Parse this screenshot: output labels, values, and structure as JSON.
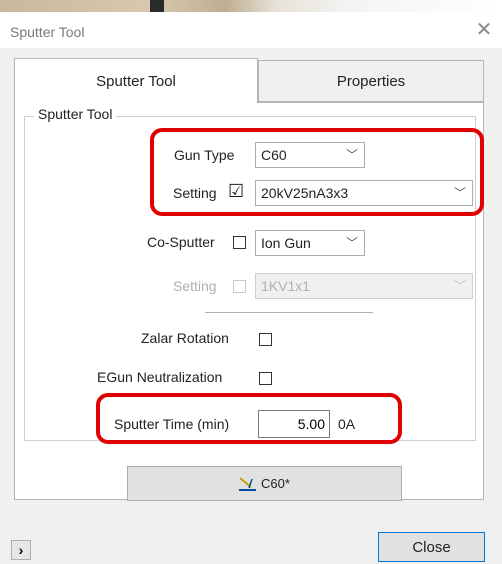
{
  "window": {
    "title": "Sputter Tool"
  },
  "tabs": {
    "active": "Sputter Tool",
    "inactive": "Properties"
  },
  "group": {
    "label": "Sputter Tool",
    "gun_type": {
      "label": "Gun Type",
      "value": "C60"
    },
    "setting": {
      "label": "Setting",
      "checked": true,
      "check_glyph": "☑",
      "value": "20kV25nA3x3"
    },
    "co_sputter": {
      "label": "Co-Sputter",
      "checked": false,
      "value": "Ion Gun"
    },
    "co_setting": {
      "label": "Setting",
      "checked": false,
      "value": "1KV1x1",
      "enabled": false
    },
    "zalar_rotation": {
      "label": "Zalar Rotation",
      "checked": false
    },
    "egun_neutralization": {
      "label": "EGun Neutralization",
      "checked": false
    },
    "sputter_time": {
      "label": "Sputter Time (min)",
      "value": "5.00",
      "unit": "0A"
    }
  },
  "action_button": {
    "label": "C60*",
    "icon": "sputter-gun-icon"
  },
  "footer": {
    "expand_glyph": "›",
    "close_label": "Close"
  },
  "colors": {
    "highlight": "#e00000",
    "close_border": "#0078d7"
  }
}
